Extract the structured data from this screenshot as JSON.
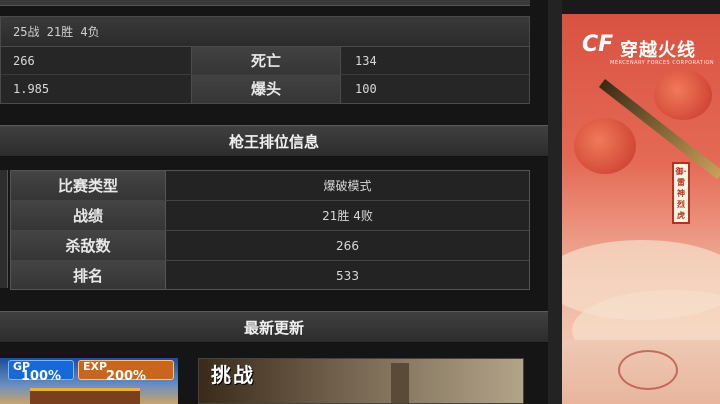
{
  "stats": {
    "record": "25战 21胜 4负",
    "rows": [
      {
        "left_value": "266",
        "key": "死亡",
        "right_value": "134"
      },
      {
        "left_value": "1.985",
        "key": "爆头",
        "right_value": "100"
      }
    ]
  },
  "ranking": {
    "title": "枪王排位信息",
    "rows": [
      {
        "key": "比赛类型",
        "value": "爆破模式"
      },
      {
        "key": "战绩",
        "value": "21胜 4败"
      },
      {
        "key": "杀敌数",
        "value": "266"
      },
      {
        "key": "排名",
        "value": "533"
      }
    ]
  },
  "news": {
    "title": "最新更新",
    "thumb1": {
      "gp_label": "GP",
      "gp_value": "100%",
      "exp_label": "EXP",
      "exp_value": "200%"
    },
    "thumb2": {
      "title": "挑战"
    }
  },
  "banner": {
    "logo_cf": "CF",
    "logo_cn": "穿越火线",
    "logo_en": "MERCENARY FORCES CORPORATION",
    "plaque_text": "御·雷神烈虎"
  },
  "colors": {
    "panel": "#151515",
    "header": "#3a3a3a",
    "banner_red": "#d8503f",
    "badge_blue": "#1769d6",
    "badge_orange": "#c9651c"
  }
}
